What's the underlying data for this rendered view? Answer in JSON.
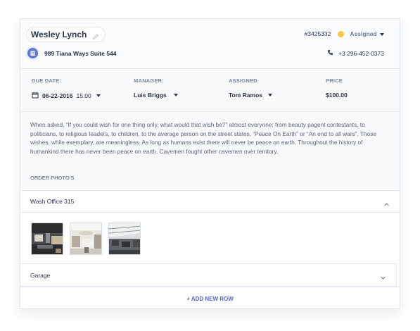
{
  "customer": {
    "name": "Wesley Lynch",
    "address": "989 Tiana Ways Suite 544",
    "order_number": "#3425332",
    "status": "Assigned",
    "status_color": "#f5c842",
    "phone": "+3 296-452-0373"
  },
  "fields": {
    "due_date": {
      "label": "DUE DATE:",
      "date": "06-22-2016",
      "time": "15:00"
    },
    "manager": {
      "label": "MANAGER:",
      "value": "Luis Briggs"
    },
    "assigned": {
      "label": "ASSIGNED",
      "value": "Tom Ramos"
    },
    "price": {
      "label": "PRICE",
      "value": "$100.00"
    }
  },
  "description": "When asked, “If you could wish for one thing only, what would that wish be?” almost everyone; from beauty pagent contestants, to politicians, to religious leaders, to children, to the average person on the street states, “Peace On Earth” or “An end to all wars”. Those wishes, while exemplary, are meaningless. As long as humans exist there will never be peace on earth. Throughout the history of humankind there has never been peace on earth. Cavemen fought other cavemen over territory,",
  "photos": {
    "section_title": "ORDER PHOTO'S",
    "rows": [
      {
        "label": "Wash Office 315",
        "expanded": true
      },
      {
        "label": "Garage",
        "expanded": false
      }
    ],
    "add_row_label": "+ ADD NEW ROW"
  },
  "icons": {
    "edit": "pencil-icon",
    "address": "building-icon",
    "phone": "phone-icon",
    "calendar": "calendar-icon",
    "expand": "chevron-up-icon",
    "collapse": "chevron-down-icon"
  },
  "colors": {
    "accent": "#5468c7",
    "address_icon": "#6178d9"
  }
}
